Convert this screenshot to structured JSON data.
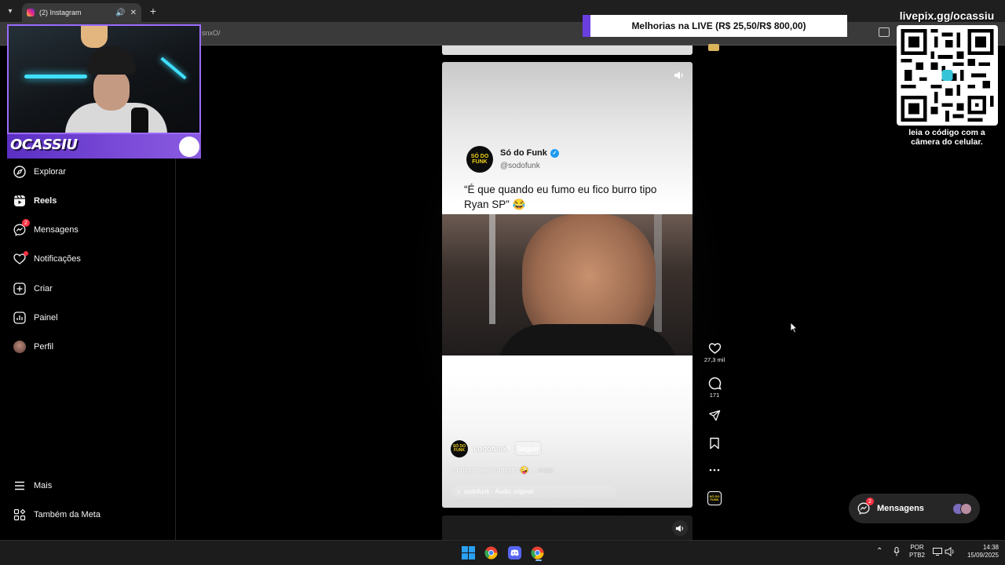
{
  "browser": {
    "tab_title": "(2) Instagram",
    "url_fragment": "snxO/",
    "new_tab_icon": "plus-icon"
  },
  "sidebar": {
    "items": [
      {
        "label": "Explorar",
        "icon": "compass-icon"
      },
      {
        "label": "Reels",
        "icon": "reels-icon",
        "active": true
      },
      {
        "label": "Mensagens",
        "icon": "messenger-icon",
        "badge": "2"
      },
      {
        "label": "Notificações",
        "icon": "heart-icon",
        "dot": true
      },
      {
        "label": "Criar",
        "icon": "plus-square-icon"
      },
      {
        "label": "Painel",
        "icon": "chart-icon"
      },
      {
        "label": "Perfil",
        "icon": "avatar"
      }
    ],
    "bottom": [
      {
        "label": "Mais",
        "icon": "menu-icon"
      },
      {
        "label": "Também da Meta",
        "icon": "meta-grid-icon"
      }
    ]
  },
  "stream": {
    "streamer_name": "OCASSIU",
    "live_bar": "Melhorias na LIVE (R$ 25,50/R$ 800,00)",
    "livepix_url": "livepix.gg/ocassiu",
    "qr_caption_1": "leia o código com a",
    "qr_caption_2": "câmera do celular."
  },
  "reel": {
    "post_account_name": "Só do Funk",
    "post_handle": "@sodofunk",
    "post_quote": "“É que quando eu fumo eu fico burro tipo Ryan SP” 😂",
    "avatar_text": "SÓ DO FUNK",
    "username": "sodofunk",
    "separator": "•",
    "follow_label": "Seguir",
    "caption": "o brilho dele sumindo 🤪",
    "caption_more": "... mais",
    "audio": "sodofunk · Áudio original",
    "likes": "27,3 mil",
    "comments": "171"
  },
  "messages_pill": {
    "label": "Mensagens",
    "badge": "2"
  },
  "taskbar": {
    "lang_1": "POR",
    "lang_2": "PTB2",
    "time": "14:38",
    "date": "15/09/2025"
  },
  "colors": {
    "accent_purple": "#6a3fe0",
    "notification_red": "#ff3040",
    "verified_blue": "#1d9bf0",
    "funk_yellow": "#f2d31b"
  }
}
